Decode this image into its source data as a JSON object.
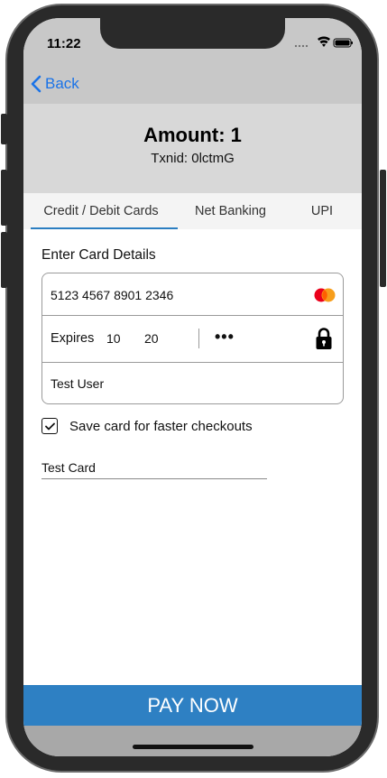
{
  "status_bar": {
    "time": "11:22"
  },
  "nav": {
    "back_label": "Back"
  },
  "header": {
    "amount": "Amount: 1",
    "txnid": "Txnid: 0lctmG"
  },
  "tabs": [
    {
      "label": "Credit / Debit Cards",
      "active": true
    },
    {
      "label": "Net Banking",
      "active": false
    },
    {
      "label": "UPI",
      "active": false
    }
  ],
  "form": {
    "section_label": "Enter Card Details",
    "card_number": "5123 4567 8901 2346",
    "card_brand_icon": "mastercard-icon",
    "expires_label": "Expires",
    "expiry_month": "10",
    "expiry_year": "20",
    "cvv_masked": "•••",
    "holder_name": "Test User",
    "save_card_label": "Save card for faster checkouts",
    "save_card_checked": true,
    "card_nickname": "Test Card"
  },
  "footer": {
    "pay_label": "PAY NOW"
  },
  "colors": {
    "accent": "#2e80c3",
    "link": "#1a73e8",
    "header_bg": "#d8d8d8",
    "nav_bg": "#c8c8c8"
  }
}
